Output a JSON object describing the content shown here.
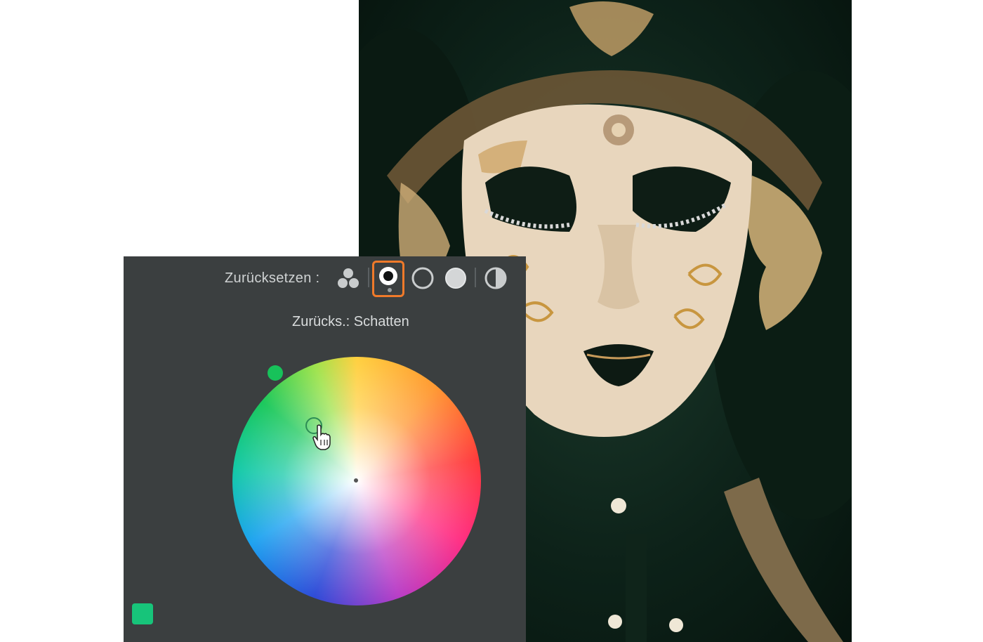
{
  "photo": {
    "subject": "venetian-mask"
  },
  "panel": {
    "reset_label": "Zurücksetzen :",
    "tooltip": "Zurücks.: Schatten",
    "tools": [
      {
        "name": "three-way-icon",
        "selected": false
      },
      {
        "name": "shadows-icon",
        "selected": true
      },
      {
        "name": "midtones-icon",
        "selected": false
      },
      {
        "name": "highlights-icon",
        "selected": false
      },
      {
        "name": "global-icon",
        "selected": false
      }
    ],
    "colors": {
      "panel_bg": "#3b3f40",
      "selection": "#f07a2a",
      "handle": "#17c25a",
      "swatch": "#17c47a"
    }
  }
}
